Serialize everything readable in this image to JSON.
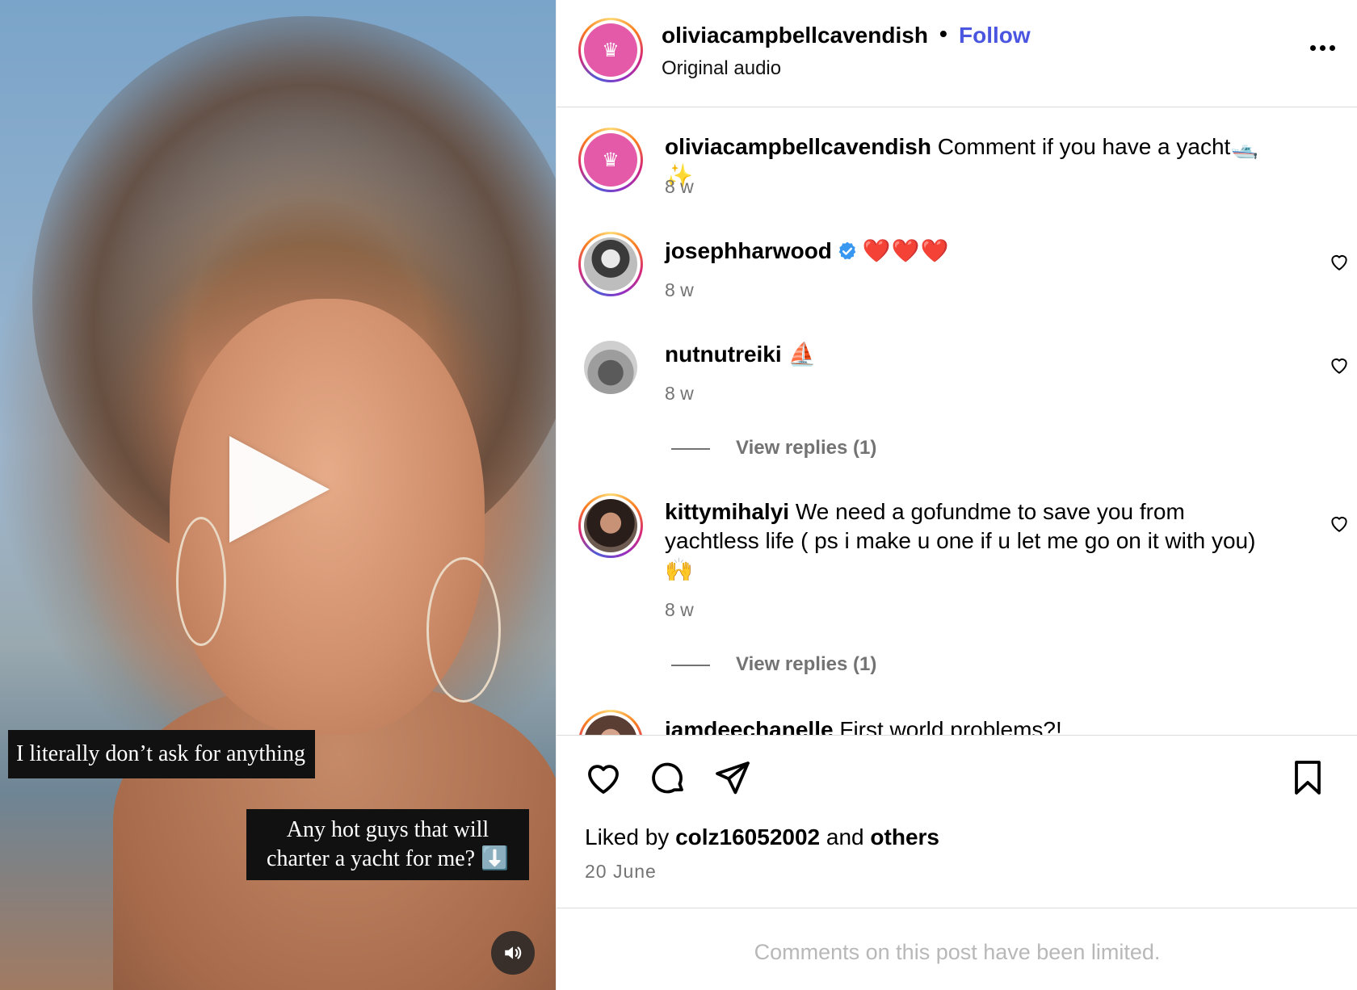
{
  "media": {
    "caption_1": "I literally don’t ask for anything",
    "caption_2": "Any hot guys that will charter a yacht for me? ⬇️"
  },
  "header": {
    "username": "oliviacampbellcavendish",
    "separator": "•",
    "follow_label": "Follow",
    "audio_label": "Original audio"
  },
  "comments": [
    {
      "username": "oliviacampbellcavendish",
      "text": "Comment if you have a yacht🛥️✨",
      "time": "8 w"
    },
    {
      "username": "josephharwood",
      "text": "❤️❤️❤️",
      "time": "8 w",
      "verified": true
    },
    {
      "username": "nutnutreiki",
      "text": "⛵",
      "time": "8 w",
      "replies": "View replies (1)"
    },
    {
      "username": "kittymihalyi",
      "text": "We need a gofundme to save you from yachtless life ( ps i make u one if u let me go on it with you) 🙌",
      "time": "8 w",
      "replies": "View replies (1)"
    },
    {
      "username": "iamdeechanelle",
      "text": "First world problems?!"
    }
  ],
  "liked": {
    "prefix": "Liked by",
    "user": "colz16052002",
    "middle": "and",
    "others": "others"
  },
  "date": "20 June",
  "limited_notice": "Comments on this post have been limited.",
  "colors": {
    "follow": "#4a56e0",
    "secondary_text": "#737373",
    "heart_red": "#e0112b",
    "verified_blue": "#3897f0",
    "brand_pink": "#e45aa8"
  }
}
